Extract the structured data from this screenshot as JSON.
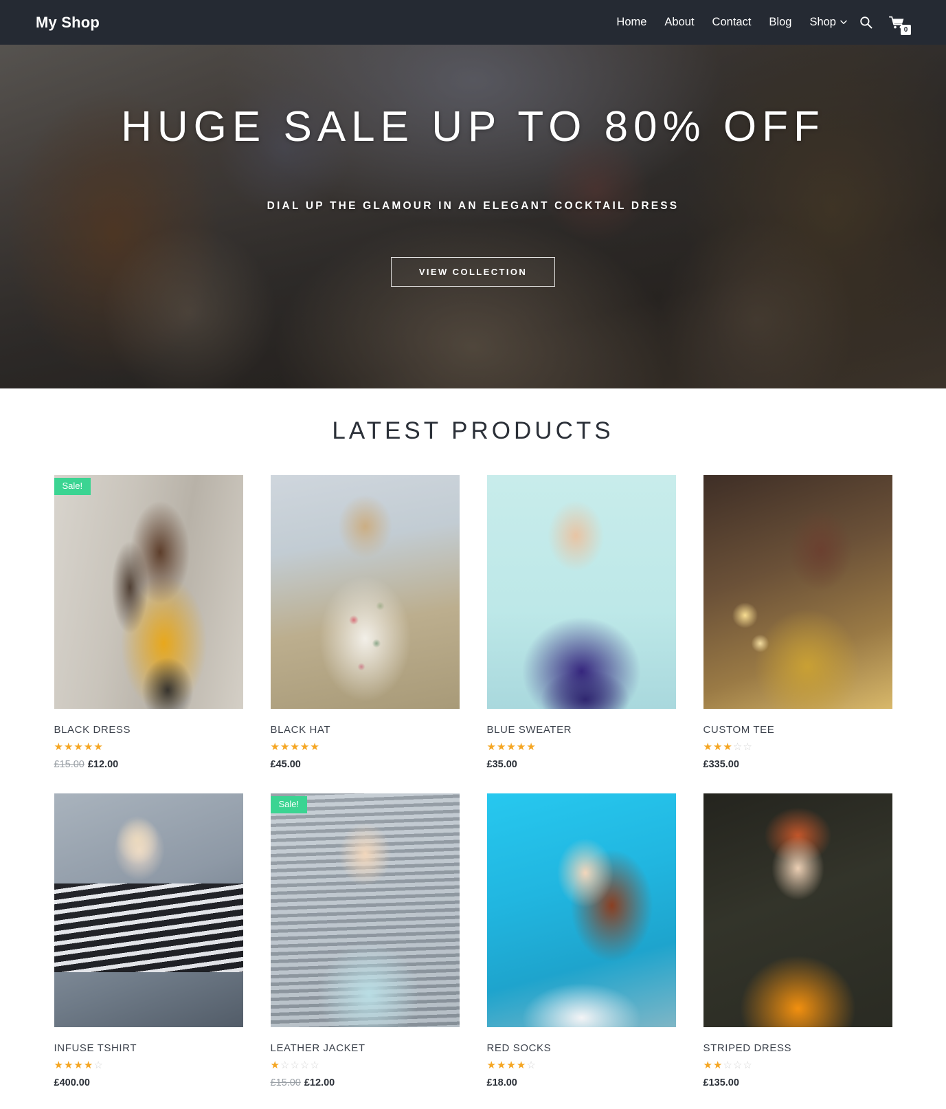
{
  "header": {
    "brand": "My Shop",
    "nav": [
      {
        "label": "Home",
        "has_caret": false
      },
      {
        "label": "About",
        "has_caret": false
      },
      {
        "label": "Contact",
        "has_caret": false
      },
      {
        "label": "Blog",
        "has_caret": false
      },
      {
        "label": "Shop",
        "has_caret": true
      }
    ],
    "search_icon": "search-icon",
    "cart_icon": "cart-icon",
    "cart_count": "0",
    "bar_color": "#252a33"
  },
  "hero": {
    "title": "HUGE SALE UP TO 80% OFF",
    "subtitle": "DIAL UP THE GLAMOUR IN AN ELEGANT COCKTAIL DRESS",
    "cta_label": "VIEW COLLECTION"
  },
  "products_section": {
    "title": "LATEST PRODUCTS",
    "sale_badge_label": "Sale!",
    "sale_badge_color": "#3bd492",
    "star_on_color": "#f5a623",
    "star_off_color": "#d6d6d6",
    "items": [
      {
        "name": "BLACK DRESS",
        "rating": 5,
        "rating_max": 5,
        "price_old": "£15.00",
        "price": "£12.00",
        "on_sale": true,
        "photo": "ph-bd"
      },
      {
        "name": "BLACK HAT",
        "rating": 5,
        "rating_max": 5,
        "price_old": "",
        "price": "£45.00",
        "on_sale": false,
        "photo": "ph-bh"
      },
      {
        "name": "BLUE SWEATER",
        "rating": 5,
        "rating_max": 5,
        "price_old": "",
        "price": "£35.00",
        "on_sale": false,
        "photo": "ph-bs"
      },
      {
        "name": "CUSTOM TEE",
        "rating": 3,
        "rating_max": 5,
        "price_old": "",
        "price": "£335.00",
        "on_sale": false,
        "photo": "ph-ct"
      },
      {
        "name": "INFUSE TSHIRT",
        "rating": 4,
        "rating_max": 5,
        "price_old": "",
        "price": "£400.00",
        "on_sale": false,
        "photo": "ph-it"
      },
      {
        "name": "LEATHER JACKET",
        "rating": 1,
        "rating_max": 5,
        "price_old": "£15.00",
        "price": "£12.00",
        "on_sale": true,
        "photo": "ph-lj"
      },
      {
        "name": "RED SOCKS",
        "rating": 4,
        "rating_max": 5,
        "price_old": "",
        "price": "£18.00",
        "on_sale": false,
        "photo": "ph-rs"
      },
      {
        "name": "STRIPED DRESS",
        "rating": 2,
        "rating_max": 5,
        "price_old": "",
        "price": "£135.00",
        "on_sale": false,
        "photo": "ph-sd"
      }
    ]
  }
}
